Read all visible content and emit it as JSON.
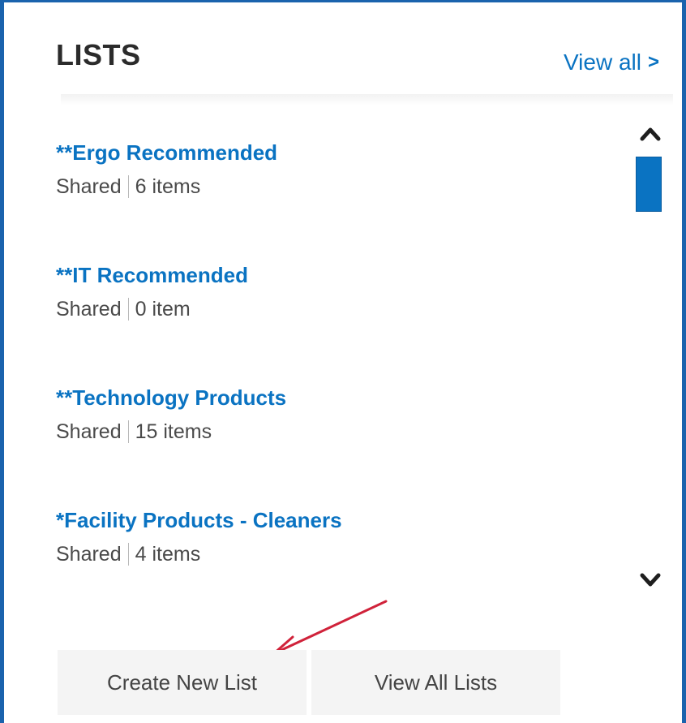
{
  "header": {
    "title": "LISTS",
    "view_all_label": "View all",
    "view_all_chevron": ">"
  },
  "lists": [
    {
      "name": "**Ergo Recommended",
      "visibility": "Shared",
      "count": "6 items"
    },
    {
      "name": "**IT Recommended",
      "visibility": "Shared",
      "count": "0 item"
    },
    {
      "name": "**Technology Products",
      "visibility": "Shared",
      "count": "15 items"
    },
    {
      "name": "*Facility Products - Cleaners",
      "visibility": "Shared",
      "count": "4 items"
    }
  ],
  "footer": {
    "create_label": "Create New List",
    "view_all_lists_label": "View All Lists"
  },
  "icons": {
    "scroll_up": "chevron-up-icon",
    "scroll_down": "chevron-down-icon",
    "annotation": "annotation-arrow-icon"
  },
  "colors": {
    "accent": "#0a73c2",
    "frame": "#1a63ad",
    "annotation": "#d0223a"
  }
}
